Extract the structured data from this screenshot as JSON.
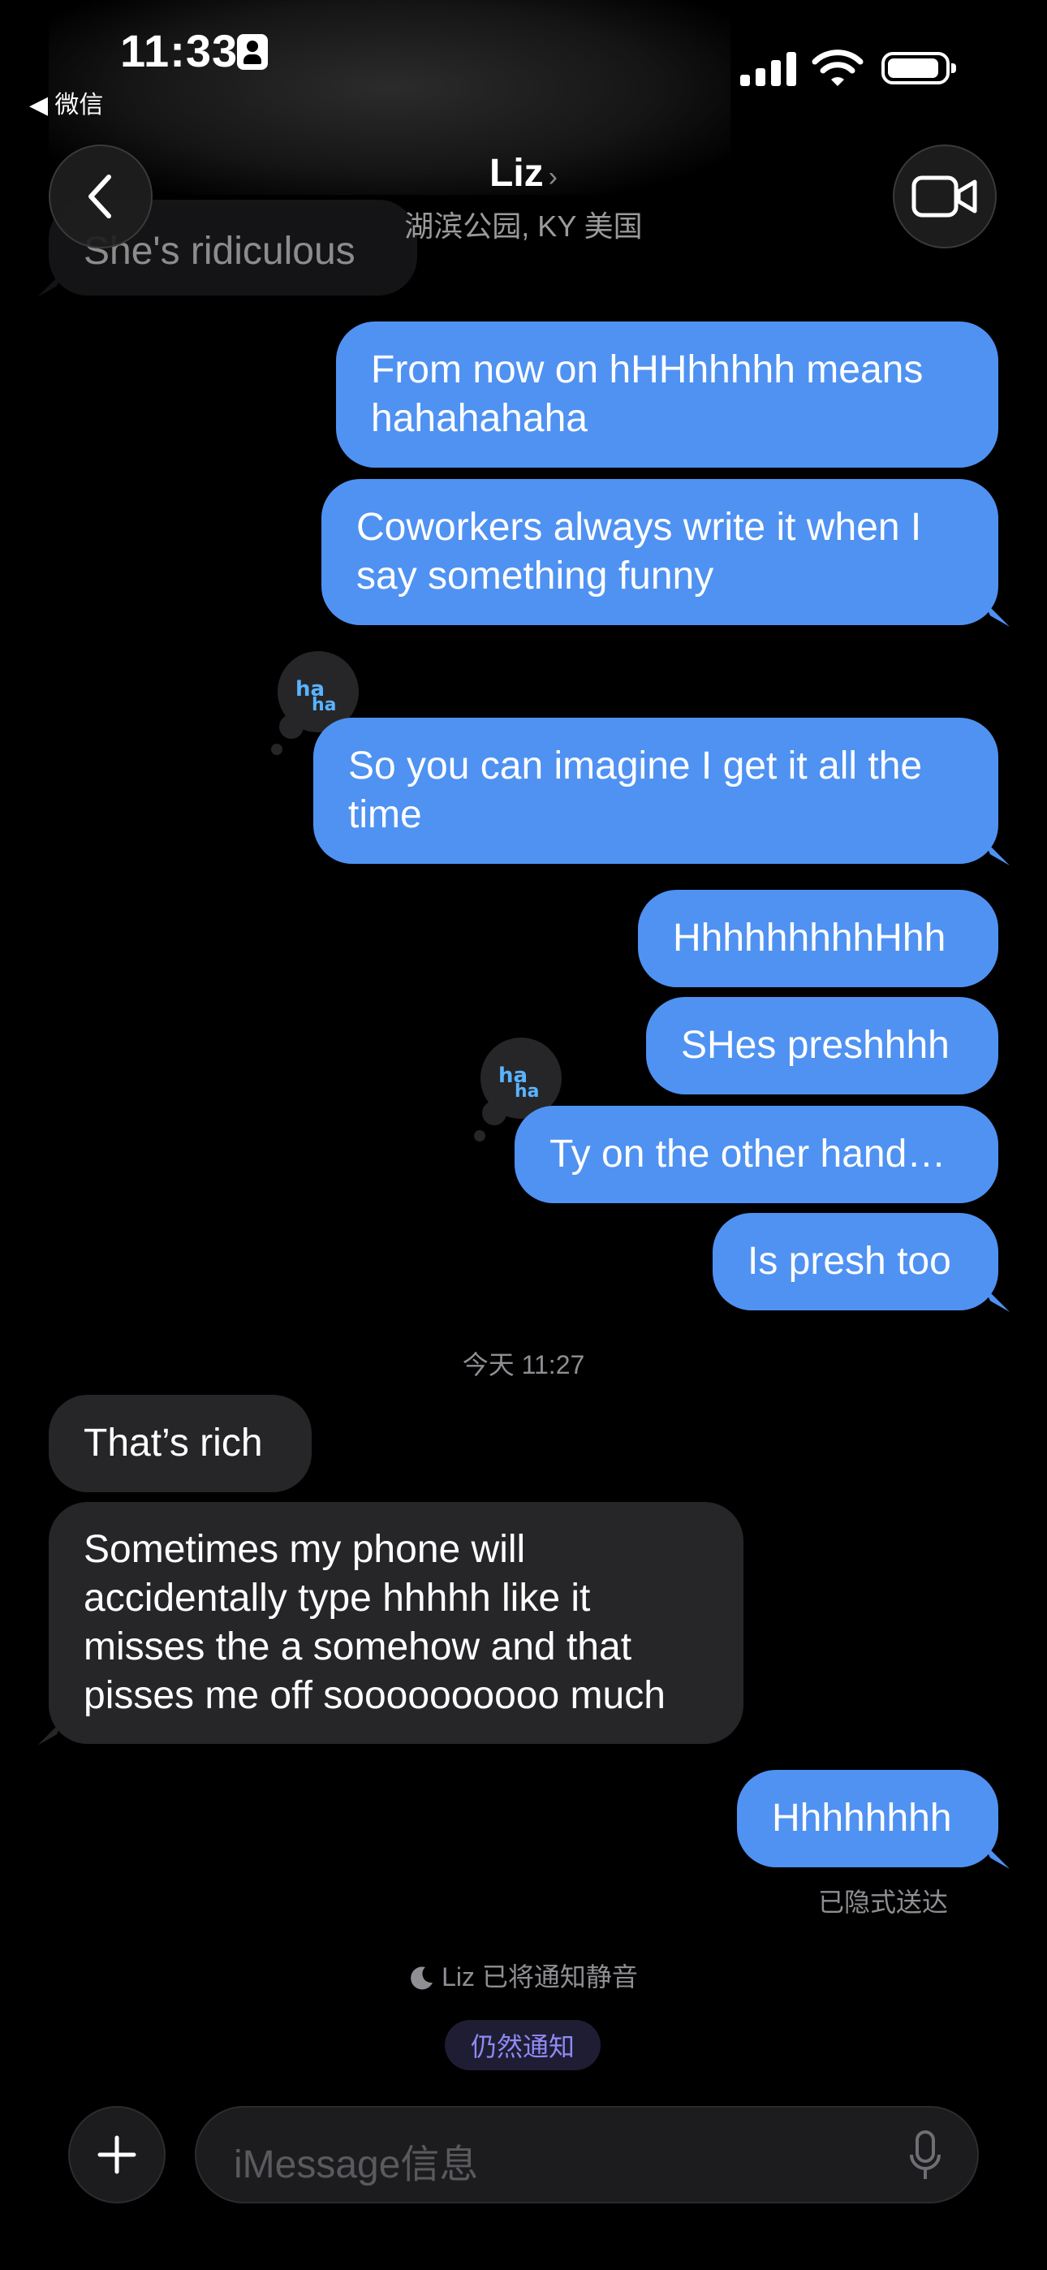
{
  "status_bar": {
    "time": "11:33",
    "back_app": "◀ 微信"
  },
  "header": {
    "contact_name": "Liz",
    "chevron": "›",
    "location": "湖滨公园, KY 美国",
    "partial_prev_message": "She's ridiculous"
  },
  "messages": [
    {
      "text": "From now on hHHhhhhh means hahahahaha",
      "dir": "sent"
    },
    {
      "text": "Coworkers always write it when I say something funny",
      "dir": "sent"
    },
    {
      "text": "So you can imagine I get it all the time",
      "dir": "sent",
      "reaction": "laugh-icon"
    },
    {
      "text": "HhhhhhhhhHhh",
      "dir": "sent"
    },
    {
      "text": "SHes preshhhh",
      "dir": "sent"
    },
    {
      "text": "Ty on the other hand…",
      "dir": "sent",
      "reaction": "laugh-icon"
    },
    {
      "text": "Is presh too",
      "dir": "sent"
    },
    {
      "text": "That’s rich",
      "dir": "received"
    },
    {
      "text": "Sometimes my phone will accidentally type hhhhh like it misses the a somehow and that pisses me off soooooooooo much",
      "dir": "received"
    },
    {
      "text": "Hhhhhhhh",
      "dir": "sent"
    }
  ],
  "timestamp": "今天 11:27",
  "delivered_status": "已隐式送达",
  "muted_notice": "Liz 已将通知静音",
  "notify_anyway": "仍然通知",
  "composer": {
    "placeholder": "iMessage信息"
  },
  "colors": {
    "sent_bubble": "#4f92f2",
    "received_bubble": "#262628",
    "background": "#000000"
  }
}
